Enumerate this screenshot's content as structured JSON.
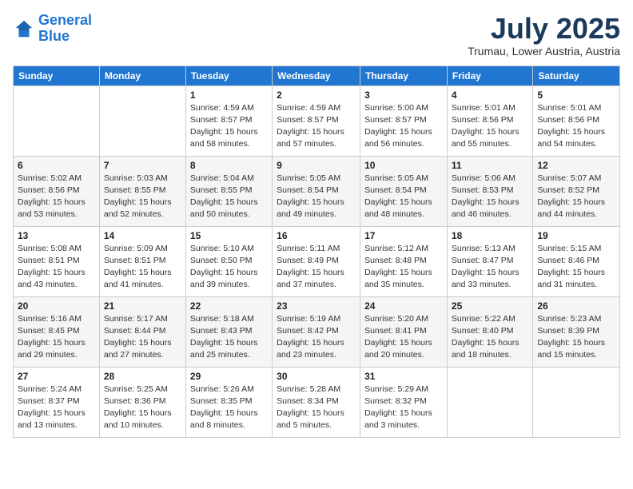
{
  "header": {
    "logo_line1": "General",
    "logo_line2": "Blue",
    "month_year": "July 2025",
    "location": "Trumau, Lower Austria, Austria"
  },
  "weekdays": [
    "Sunday",
    "Monday",
    "Tuesday",
    "Wednesday",
    "Thursday",
    "Friday",
    "Saturday"
  ],
  "weeks": [
    [
      {
        "day": "",
        "sunrise": "",
        "sunset": "",
        "daylight": ""
      },
      {
        "day": "",
        "sunrise": "",
        "sunset": "",
        "daylight": ""
      },
      {
        "day": "1",
        "sunrise": "Sunrise: 4:59 AM",
        "sunset": "Sunset: 8:57 PM",
        "daylight": "Daylight: 15 hours and 58 minutes."
      },
      {
        "day": "2",
        "sunrise": "Sunrise: 4:59 AM",
        "sunset": "Sunset: 8:57 PM",
        "daylight": "Daylight: 15 hours and 57 minutes."
      },
      {
        "day": "3",
        "sunrise": "Sunrise: 5:00 AM",
        "sunset": "Sunset: 8:57 PM",
        "daylight": "Daylight: 15 hours and 56 minutes."
      },
      {
        "day": "4",
        "sunrise": "Sunrise: 5:01 AM",
        "sunset": "Sunset: 8:56 PM",
        "daylight": "Daylight: 15 hours and 55 minutes."
      },
      {
        "day": "5",
        "sunrise": "Sunrise: 5:01 AM",
        "sunset": "Sunset: 8:56 PM",
        "daylight": "Daylight: 15 hours and 54 minutes."
      }
    ],
    [
      {
        "day": "6",
        "sunrise": "Sunrise: 5:02 AM",
        "sunset": "Sunset: 8:56 PM",
        "daylight": "Daylight: 15 hours and 53 minutes."
      },
      {
        "day": "7",
        "sunrise": "Sunrise: 5:03 AM",
        "sunset": "Sunset: 8:55 PM",
        "daylight": "Daylight: 15 hours and 52 minutes."
      },
      {
        "day": "8",
        "sunrise": "Sunrise: 5:04 AM",
        "sunset": "Sunset: 8:55 PM",
        "daylight": "Daylight: 15 hours and 50 minutes."
      },
      {
        "day": "9",
        "sunrise": "Sunrise: 5:05 AM",
        "sunset": "Sunset: 8:54 PM",
        "daylight": "Daylight: 15 hours and 49 minutes."
      },
      {
        "day": "10",
        "sunrise": "Sunrise: 5:05 AM",
        "sunset": "Sunset: 8:54 PM",
        "daylight": "Daylight: 15 hours and 48 minutes."
      },
      {
        "day": "11",
        "sunrise": "Sunrise: 5:06 AM",
        "sunset": "Sunset: 8:53 PM",
        "daylight": "Daylight: 15 hours and 46 minutes."
      },
      {
        "day": "12",
        "sunrise": "Sunrise: 5:07 AM",
        "sunset": "Sunset: 8:52 PM",
        "daylight": "Daylight: 15 hours and 44 minutes."
      }
    ],
    [
      {
        "day": "13",
        "sunrise": "Sunrise: 5:08 AM",
        "sunset": "Sunset: 8:51 PM",
        "daylight": "Daylight: 15 hours and 43 minutes."
      },
      {
        "day": "14",
        "sunrise": "Sunrise: 5:09 AM",
        "sunset": "Sunset: 8:51 PM",
        "daylight": "Daylight: 15 hours and 41 minutes."
      },
      {
        "day": "15",
        "sunrise": "Sunrise: 5:10 AM",
        "sunset": "Sunset: 8:50 PM",
        "daylight": "Daylight: 15 hours and 39 minutes."
      },
      {
        "day": "16",
        "sunrise": "Sunrise: 5:11 AM",
        "sunset": "Sunset: 8:49 PM",
        "daylight": "Daylight: 15 hours and 37 minutes."
      },
      {
        "day": "17",
        "sunrise": "Sunrise: 5:12 AM",
        "sunset": "Sunset: 8:48 PM",
        "daylight": "Daylight: 15 hours and 35 minutes."
      },
      {
        "day": "18",
        "sunrise": "Sunrise: 5:13 AM",
        "sunset": "Sunset: 8:47 PM",
        "daylight": "Daylight: 15 hours and 33 minutes."
      },
      {
        "day": "19",
        "sunrise": "Sunrise: 5:15 AM",
        "sunset": "Sunset: 8:46 PM",
        "daylight": "Daylight: 15 hours and 31 minutes."
      }
    ],
    [
      {
        "day": "20",
        "sunrise": "Sunrise: 5:16 AM",
        "sunset": "Sunset: 8:45 PM",
        "daylight": "Daylight: 15 hours and 29 minutes."
      },
      {
        "day": "21",
        "sunrise": "Sunrise: 5:17 AM",
        "sunset": "Sunset: 8:44 PM",
        "daylight": "Daylight: 15 hours and 27 minutes."
      },
      {
        "day": "22",
        "sunrise": "Sunrise: 5:18 AM",
        "sunset": "Sunset: 8:43 PM",
        "daylight": "Daylight: 15 hours and 25 minutes."
      },
      {
        "day": "23",
        "sunrise": "Sunrise: 5:19 AM",
        "sunset": "Sunset: 8:42 PM",
        "daylight": "Daylight: 15 hours and 23 minutes."
      },
      {
        "day": "24",
        "sunrise": "Sunrise: 5:20 AM",
        "sunset": "Sunset: 8:41 PM",
        "daylight": "Daylight: 15 hours and 20 minutes."
      },
      {
        "day": "25",
        "sunrise": "Sunrise: 5:22 AM",
        "sunset": "Sunset: 8:40 PM",
        "daylight": "Daylight: 15 hours and 18 minutes."
      },
      {
        "day": "26",
        "sunrise": "Sunrise: 5:23 AM",
        "sunset": "Sunset: 8:39 PM",
        "daylight": "Daylight: 15 hours and 15 minutes."
      }
    ],
    [
      {
        "day": "27",
        "sunrise": "Sunrise: 5:24 AM",
        "sunset": "Sunset: 8:37 PM",
        "daylight": "Daylight: 15 hours and 13 minutes."
      },
      {
        "day": "28",
        "sunrise": "Sunrise: 5:25 AM",
        "sunset": "Sunset: 8:36 PM",
        "daylight": "Daylight: 15 hours and 10 minutes."
      },
      {
        "day": "29",
        "sunrise": "Sunrise: 5:26 AM",
        "sunset": "Sunset: 8:35 PM",
        "daylight": "Daylight: 15 hours and 8 minutes."
      },
      {
        "day": "30",
        "sunrise": "Sunrise: 5:28 AM",
        "sunset": "Sunset: 8:34 PM",
        "daylight": "Daylight: 15 hours and 5 minutes."
      },
      {
        "day": "31",
        "sunrise": "Sunrise: 5:29 AM",
        "sunset": "Sunset: 8:32 PM",
        "daylight": "Daylight: 15 hours and 3 minutes."
      },
      {
        "day": "",
        "sunrise": "",
        "sunset": "",
        "daylight": ""
      },
      {
        "day": "",
        "sunrise": "",
        "sunset": "",
        "daylight": ""
      }
    ]
  ]
}
